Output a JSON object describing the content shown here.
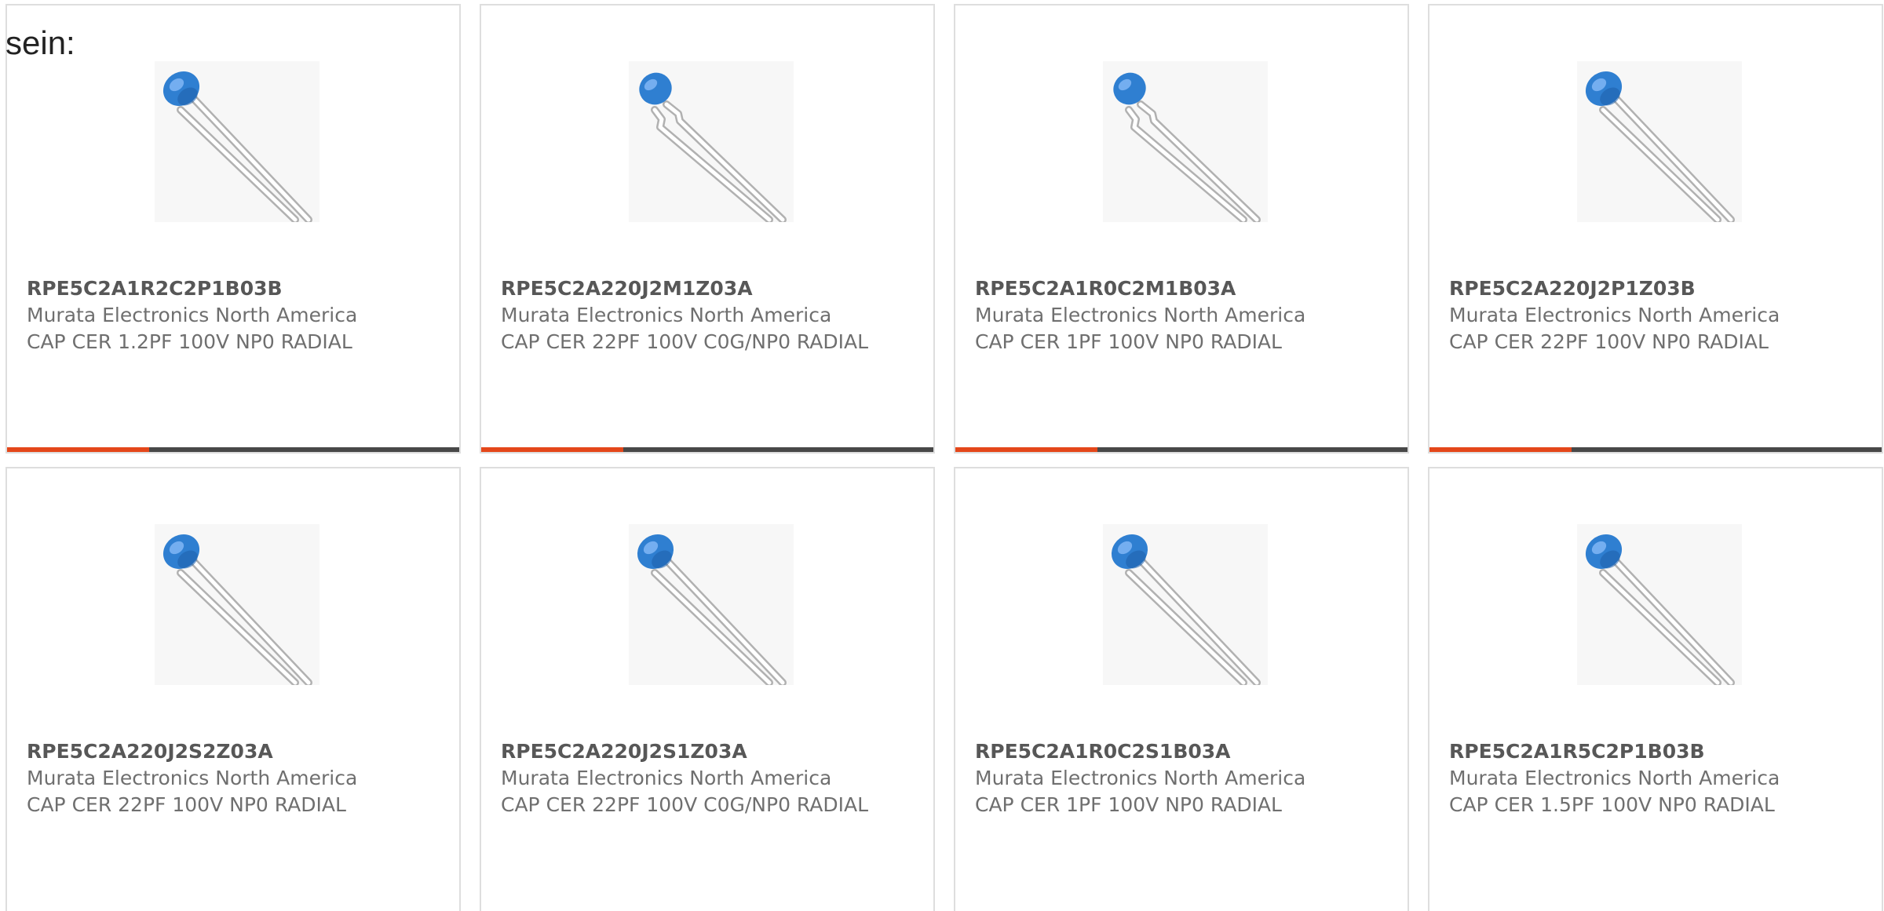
{
  "lead_text": "sein:",
  "colors": {
    "accent": "#e4471a",
    "bar": "#484848",
    "capacitor_body": "#2f7fd1",
    "text": "#6f6f6f"
  },
  "cards": [
    {
      "part_number": "RPE5C2A1R2C2P1B03B",
      "manufacturer": "Murata Electronics North America",
      "description": "CAP CER 1.2PF 100V NP0 RADIAL",
      "image_icon": "radial-ceramic-capacitor-straight-lead-icon"
    },
    {
      "part_number": "RPE5C2A220J2M1Z03A",
      "manufacturer": "Murata Electronics North America",
      "description": "CAP CER 22PF 100V C0G/NP0 RADIAL",
      "image_icon": "radial-ceramic-capacitor-kinked-lead-icon"
    },
    {
      "part_number": "RPE5C2A1R0C2M1B03A",
      "manufacturer": "Murata Electronics North America",
      "description": "CAP CER 1PF 100V NP0 RADIAL",
      "image_icon": "radial-ceramic-capacitor-kinked-lead-icon"
    },
    {
      "part_number": "RPE5C2A220J2P1Z03B",
      "manufacturer": "Murata Electronics North America",
      "description": "CAP CER 22PF 100V NP0 RADIAL",
      "image_icon": "radial-ceramic-capacitor-straight-lead-icon"
    },
    {
      "part_number": "RPE5C2A220J2S2Z03A",
      "manufacturer": "Murata Electronics North America",
      "description": "CAP CER 22PF 100V NP0 RADIAL",
      "image_icon": "radial-ceramic-capacitor-straight-lead-icon"
    },
    {
      "part_number": "RPE5C2A220J2S1Z03A",
      "manufacturer": "Murata Electronics North America",
      "description": "CAP CER 22PF 100V C0G/NP0 RADIAL",
      "image_icon": "radial-ceramic-capacitor-straight-lead-icon"
    },
    {
      "part_number": "RPE5C2A1R0C2S1B03A",
      "manufacturer": "Murata Electronics North America",
      "description": "CAP CER 1PF 100V NP0 RADIAL",
      "image_icon": "radial-ceramic-capacitor-straight-lead-icon"
    },
    {
      "part_number": "RPE5C2A1R5C2P1B03B",
      "manufacturer": "Murata Electronics North America",
      "description": "CAP CER 1.5PF 100V NP0 RADIAL",
      "image_icon": "radial-ceramic-capacitor-straight-lead-icon"
    }
  ]
}
